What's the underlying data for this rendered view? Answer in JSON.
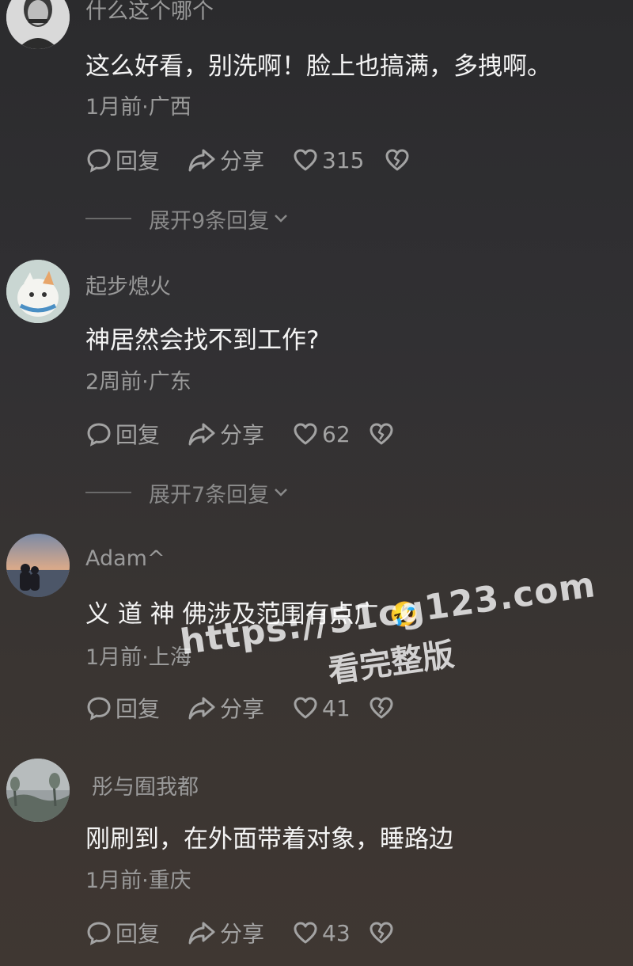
{
  "comments": [
    {
      "username": "什么这个哪个",
      "text": "这么好看，别洗啊！脸上也搞满，多拽啊。",
      "meta": "1月前·广西",
      "reply_label": "回复",
      "share_label": "分享",
      "likes": "315",
      "expand_label": "展开9条回复",
      "avatar_icon": "portrait-avatar"
    },
    {
      "username": "起步熄火",
      "text": "神居然会找不到工作?",
      "meta": "2周前·广东",
      "reply_label": "回复",
      "share_label": "分享",
      "likes": "62",
      "expand_label": "展开7条回复",
      "avatar_icon": "cartoon-cat-avatar"
    },
    {
      "username": "Adam^",
      "text": "义 道 神 佛涉及范围有点广",
      "emoji": "🤣",
      "meta": "1月前·上海",
      "reply_label": "回复",
      "share_label": "分享",
      "likes": "41",
      "avatar_icon": "sunset-couple-avatar"
    },
    {
      "username": "彤与囿我都",
      "text": "刚刷到，在外面带着对象，睡路边",
      "meta": "1月前·重庆",
      "reply_label": "回复",
      "share_label": "分享",
      "likes": "43",
      "avatar_icon": "foggy-landscape-avatar"
    }
  ],
  "watermark": {
    "url": "https://51cg123.com",
    "caption": "看完整版"
  },
  "colors": {
    "text": "#f4f4f4",
    "muted": "#9a9a9a",
    "background": "#2f2f31"
  }
}
